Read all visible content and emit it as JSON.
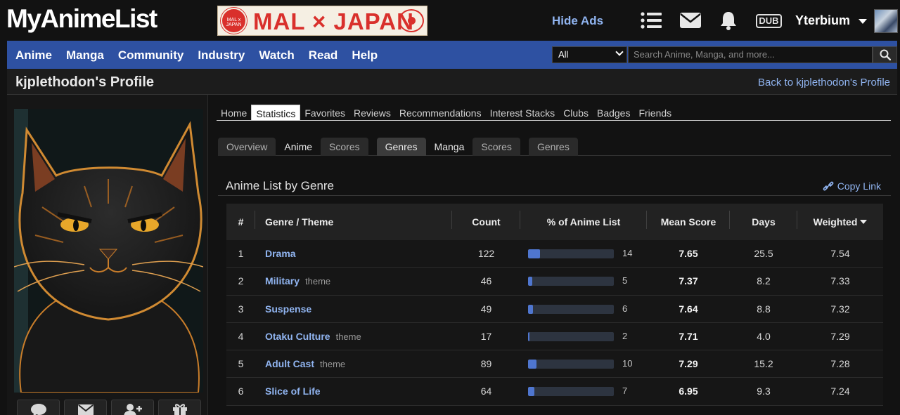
{
  "header": {
    "logo": "MyAnimeList",
    "banner": "MAL × JAPAN",
    "banner_seal": "MAL x JAPAN",
    "hide_ads": "Hide Ads",
    "dub_badge": "DUB",
    "username": "Yterbium"
  },
  "nav": {
    "items": [
      "Anime",
      "Manga",
      "Community",
      "Industry",
      "Watch",
      "Read",
      "Help"
    ],
    "filter_value": "All",
    "search_placeholder": "Search Anime, Manga, and more..."
  },
  "profile": {
    "title": "kjplethodon's Profile",
    "back_link": "Back to kjplethodon's Profile"
  },
  "profile_tabs": [
    "Home",
    "Statistics",
    "Favorites",
    "Reviews",
    "Recommendations",
    "Interest Stacks",
    "Clubs",
    "Badges",
    "Friends"
  ],
  "profile_tabs_active": "Statistics",
  "stat_tabs": {
    "overview": "Overview",
    "anime": "Anime",
    "anime_scores": "Scores",
    "anime_genres": "Genres",
    "manga": "Manga",
    "manga_scores": "Scores",
    "manga_genres": "Genres"
  },
  "section": {
    "title": "Anime List by Genre",
    "copy_link": "Copy Link"
  },
  "table": {
    "headers": {
      "rank": "#",
      "genre": "Genre / Theme",
      "count": "Count",
      "pct": "% of Anime List",
      "mean": "Mean Score",
      "days": "Days",
      "weighted": "Weighted"
    },
    "rows": [
      {
        "rank": "1",
        "genre": "Drama",
        "tag": "",
        "count": "122",
        "pct": 14,
        "pct_label": "14",
        "mean": "7.65",
        "days": "25.5",
        "weighted": "7.54"
      },
      {
        "rank": "2",
        "genre": "Military",
        "tag": "theme",
        "count": "46",
        "pct": 5,
        "pct_label": "5",
        "mean": "7.37",
        "days": "8.2",
        "weighted": "7.33"
      },
      {
        "rank": "3",
        "genre": "Suspense",
        "tag": "",
        "count": "49",
        "pct": 6,
        "pct_label": "6",
        "mean": "7.64",
        "days": "8.8",
        "weighted": "7.32"
      },
      {
        "rank": "4",
        "genre": "Otaku Culture",
        "tag": "theme",
        "count": "17",
        "pct": 2,
        "pct_label": "2",
        "mean": "7.71",
        "days": "4.0",
        "weighted": "7.29"
      },
      {
        "rank": "5",
        "genre": "Adult Cast",
        "tag": "theme",
        "count": "89",
        "pct": 10,
        "pct_label": "10",
        "mean": "7.29",
        "days": "15.2",
        "weighted": "7.28"
      },
      {
        "rank": "6",
        "genre": "Slice of Life",
        "tag": "",
        "count": "64",
        "pct": 7,
        "pct_label": "7",
        "mean": "6.95",
        "days": "9.3",
        "weighted": "7.24"
      }
    ]
  },
  "colors": {
    "nav_blue": "#2e51a2",
    "link_blue": "#90b4f0",
    "bar_fill": "#4f76cf",
    "bar_track": "#2d3440"
  }
}
